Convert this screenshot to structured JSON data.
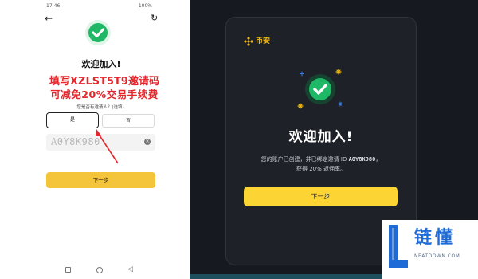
{
  "phone": {
    "status_time": "17:46",
    "status_right": "100%",
    "title": "欢迎加入!",
    "promo_line1": "填写XZLST5T9邀请码",
    "promo_line2": "可减免20%交易手续费",
    "question": "您是否有邀请人？(选填)",
    "option_yes": "是",
    "option_no": "否",
    "referral_value": "A0Y8K980",
    "next_label": "下一步"
  },
  "card": {
    "brand_name": "币安",
    "title": "欢迎加入!",
    "desc_prefix": "您的账户已创建，并已绑定邀请 ID",
    "desc_code": "A0Y8K980",
    "desc_suffix": "，",
    "desc_line2": "获得 20% 返佣率。",
    "next_label": "下一步"
  },
  "watermark": {
    "title": "链懂",
    "subtitle": "NEATDOWN.COM"
  },
  "colors": {
    "brand_yellow": "#f0b90b",
    "button_yellow": "#fcd535",
    "check_green": "#1fb866",
    "promo_red": "#e5262b"
  }
}
